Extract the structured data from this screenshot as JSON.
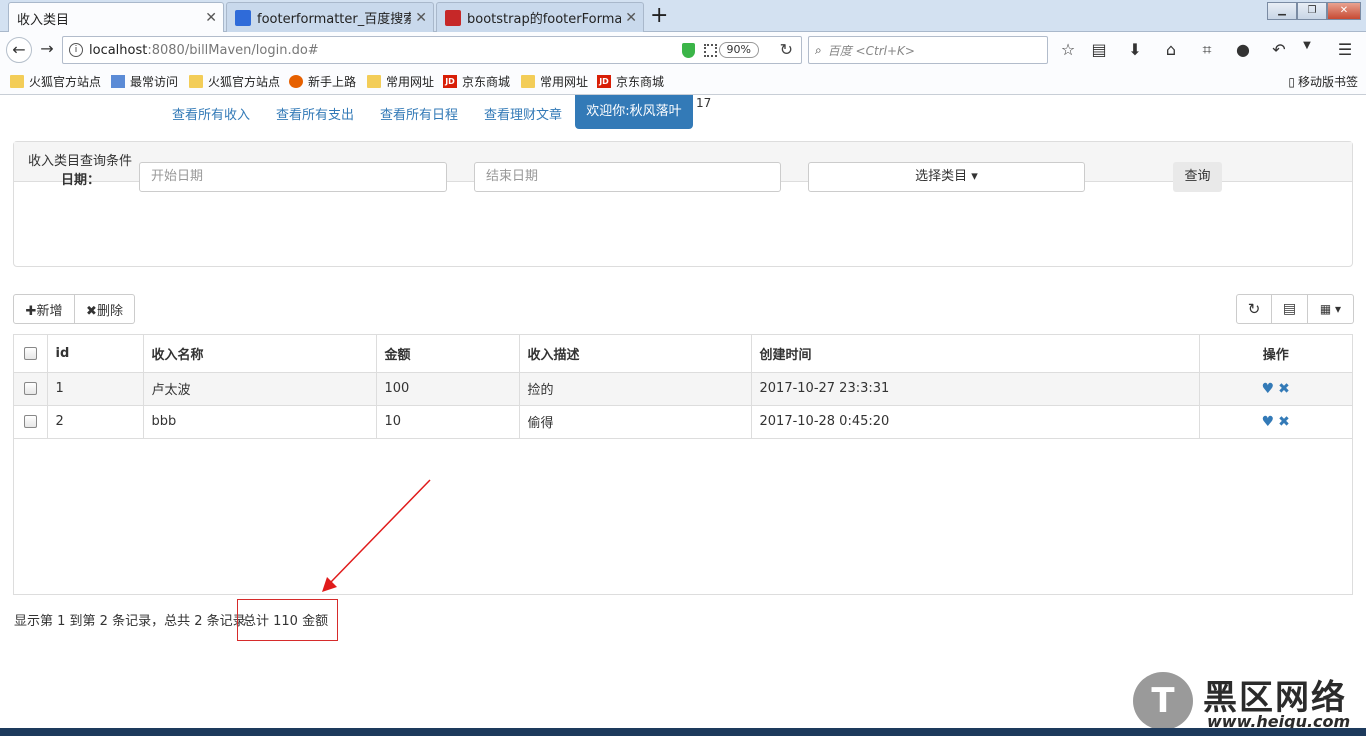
{
  "browser": {
    "tabs": [
      {
        "title": "收入类目",
        "active": true
      },
      {
        "title": "footerformatter_百度搜索",
        "active": false
      },
      {
        "title": "bootstrap的footerFormatte",
        "active": false
      }
    ],
    "url_host": "localhost",
    "url_rest": ":8080/billMaven/login.do#",
    "zoom": "90%",
    "search_placeholder": "百度 <Ctrl+K>",
    "bookmarks": [
      "火狐官方站点",
      "最常访问",
      "火狐官方站点",
      "新手上路",
      "常用网址",
      "京东商城",
      "常用网址",
      "京东商城"
    ],
    "mobile_bookmarks": "移动版书签"
  },
  "topnav": {
    "links": [
      "查看所有收入",
      "查看所有支出",
      "查看所有日程",
      "查看理财文章"
    ],
    "welcome": "欢迎你:秋风落叶",
    "badge": "17"
  },
  "query_panel": {
    "title": "收入类目查询条件",
    "date_label": "日期：",
    "start_placeholder": "开始日期",
    "end_placeholder": "结束日期",
    "category_dropdown": "选择类目 ▾",
    "query_button": "查询"
  },
  "toolbar": {
    "add_label": "✚新增",
    "delete_label": "✖删除"
  },
  "table": {
    "headers": [
      "id",
      "收入名称",
      "金额",
      "收入描述",
      "创建时间",
      "操作"
    ],
    "rows": [
      {
        "id": "1",
        "name": "卢太波",
        "amount": "100",
        "desc": "捡的",
        "created": "2017-10-27 23:3:31"
      },
      {
        "id": "2",
        "name": "bbb",
        "amount": "10",
        "desc": "偷得",
        "created": "2017-10-28 0:45:20"
      }
    ]
  },
  "footer": {
    "pagination_info": "显示第 1 到第 2 条记录，总共 2 条记录",
    "total_text": "总计 110 金额"
  },
  "watermark": {
    "name": "黑区网络",
    "url": "www.heiqu.com"
  },
  "colors": {
    "primary": "#337ab7",
    "annotation": "#d62b2b"
  }
}
